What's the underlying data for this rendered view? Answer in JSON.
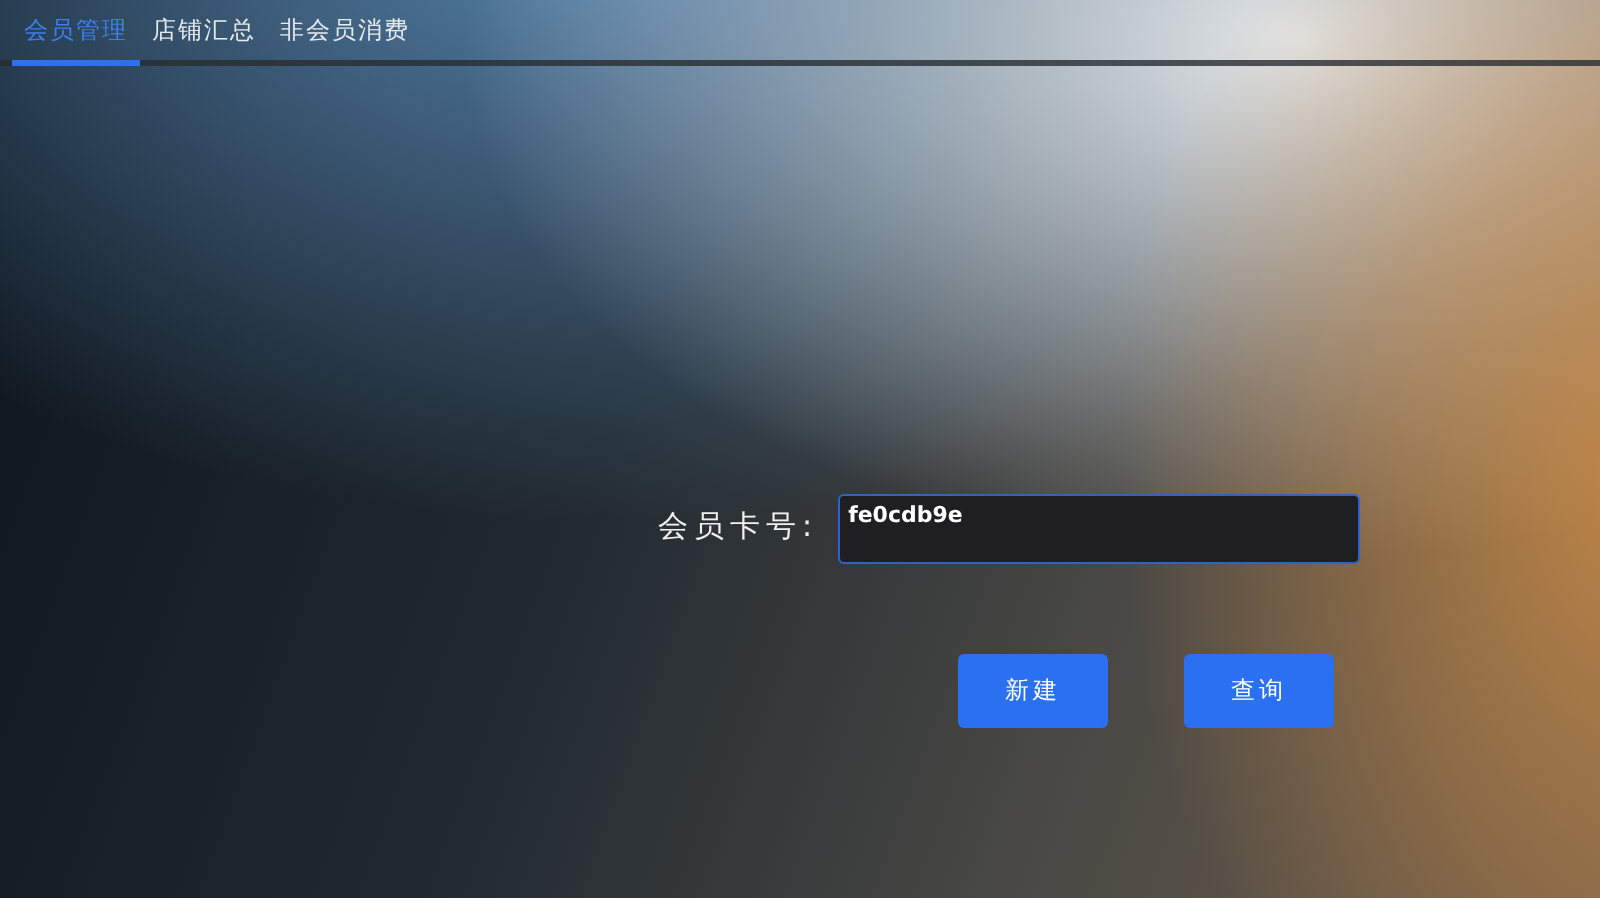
{
  "tabs": [
    {
      "label": "会员管理",
      "selected": true
    },
    {
      "label": "店铺汇总",
      "selected": false
    },
    {
      "label": "非会员消费",
      "selected": false
    }
  ],
  "form": {
    "label": "会员卡号:",
    "card_number": "fe0cdb9e"
  },
  "buttons": [
    "新建",
    "查询"
  ]
}
